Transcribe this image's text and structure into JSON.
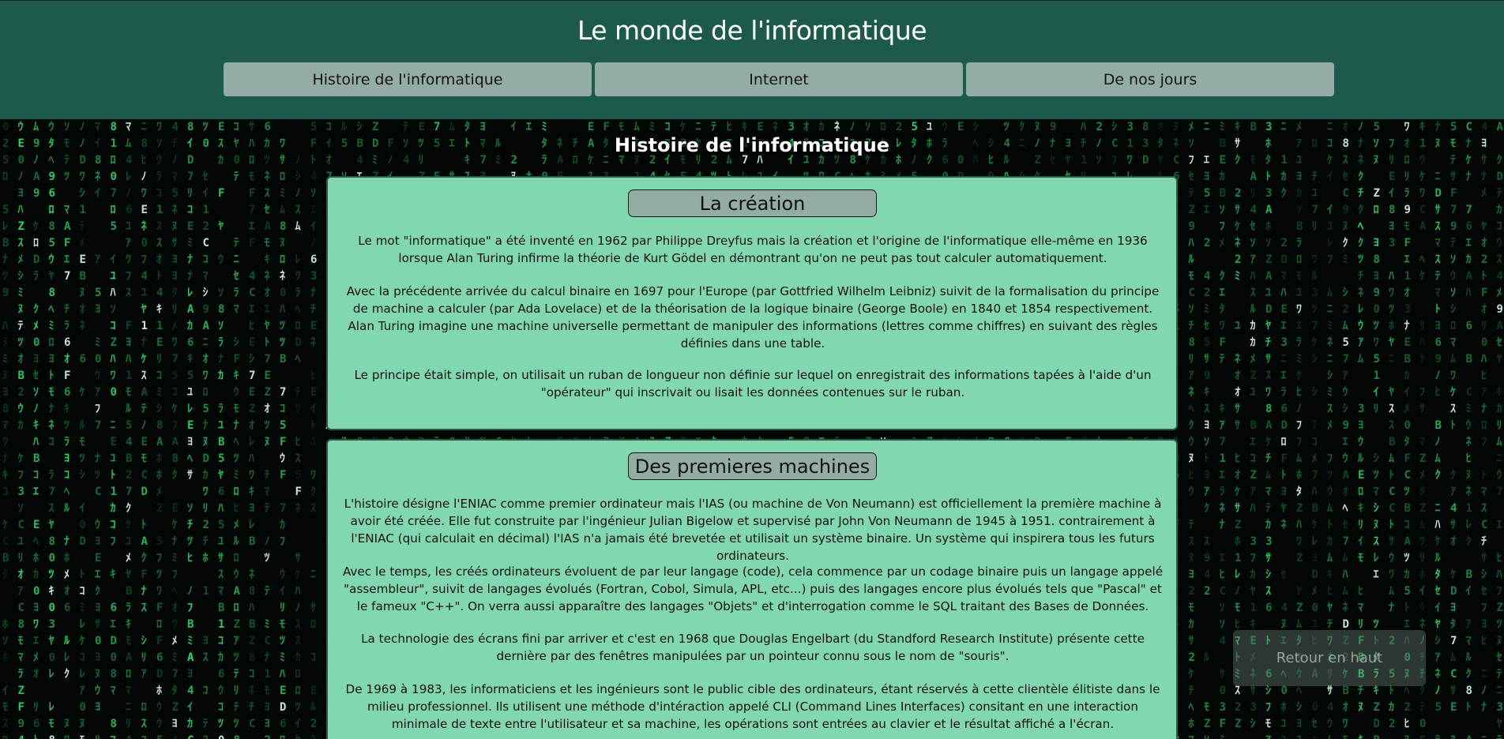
{
  "site": {
    "title": "Le monde de l'informatique"
  },
  "nav": {
    "items": [
      {
        "label": "Histoire de l'informatique"
      },
      {
        "label": "Internet"
      },
      {
        "label": "De nos jours"
      }
    ]
  },
  "main": {
    "section_title": "Histoire de l'informatique",
    "cards": [
      {
        "title": "La création",
        "paragraphs": [
          "Le mot \"informatique\" a été inventé en 1962 par Philippe Dreyfus mais la création et l'origine de l'informatique elle-même en 1936 lorsque Alan Turing infirme la théorie de Kurt Gödel en démontrant qu'on ne peut pas tout calculer automatiquement.",
          "Avec la précédente arrivée du calcul binaire en 1697 pour l'Europe (par Gottfried Wilhelm Leibniz) suivit de la formalisation du principe de machine a calculer (par Ada Lovelace) et de la théorisation de la logique binaire (George Boole) en 1840 et 1854 respectivement. Alan Turing imagine une machine universelle permettant de manipuler des informations (lettres comme chiffres) en suivant des règles définies dans une table.",
          "Le principe était simple, on utilisait un ruban de longueur non définie sur lequel on enregistrait des informations tapées à l'aide d'un \"opérateur\" qui inscrivait ou lisait les données contenues sur le ruban."
        ]
      },
      {
        "title": "Des premieres machines",
        "paragraphs": [
          "L'histoire désigne l'ENIAC comme premier ordinateur mais l'IAS (ou machine de Von Neumann) est officiellement la première machine à avoir été créée. Elle fut construite par l'ingénieur Julian Bigelow et supervisé par John Von Neumann de 1945 à 1951. contrairement à l'ENIAC (qui calculait en décimal) l'IAS n'a jamais été brevetée et utilisait un système binaire. Un système qui inspirera tous les futurs ordinateurs.",
          "Avec le temps, les créés ordinateurs évoluent de par leur langage (code), cela commence par un codage binaire puis un langage appelé \"assembleur\", suivit de langages évolués (Fortran, Cobol, Simula, APL, etc...) puis des langages encore plus évolués tels que \"Pascal\" et le fameux \"C++\". On verra aussi apparaître des langages \"Objets\" et d'interrogation comme le SQL traitant des Bases de Données.",
          "La technologie des écrans fini par arriver et c'est en 1968 que Douglas Engelbart (du Standford Research Institute) présente cette dernière par des fenêtres manipulées par un pointeur connu sous le nom de \"souris\".",
          "De 1969 à 1983, les informaticiens et les ingénieurs sont le public cible des ordinateurs, étant réservés à cette clientèle élitiste dans le milieu professionnel. Ils utilisent une méthode d'intéraction appelé CLI (Command Lines Interfaces) consitant en une interaction minimale de texte entre l'utilisateur et sa machine, les opérations sont entrées au clavier et le résultat affiché a l'écran."
        ]
      }
    ]
  },
  "back_to_top": {
    "label": "Retour en haut"
  },
  "colors": {
    "header_bg": "#1d5a4b",
    "nav_button_bg": "#93ada6",
    "card_bg": "#80d7b0",
    "matrix_green": "#2fe06a"
  }
}
